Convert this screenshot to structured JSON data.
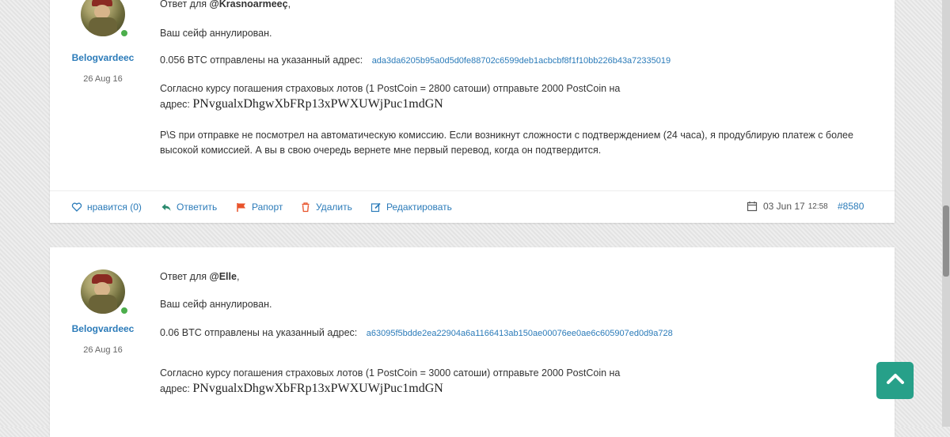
{
  "posts": [
    {
      "author": "Belogvardeec",
      "date": "26 Aug 16",
      "reply_prefix": "Ответ для",
      "mention": "@Krasnoarmeeç",
      "mention_suffix": ",",
      "line1": "Ваш сейф аннулирован.",
      "sent_text": "0.056 BTC отправлены на указанный адрес:",
      "sent_address": "ada3da6205b95a0d5d0fe88702c6599deb1acbcbf8f1f10bb226b43a72335019",
      "rate_text": "Согласно курсу погашения страховых лотов (1 PostCoin = 2800 сатоши) отправьте 2000  PostCoin на",
      "addr_label": "адрес:",
      "postcoin_address": "PNvgualxDhgwXbFRp13xPWXUWjPuc1mdGN",
      "ps_text": "P\\S при отправке не посмотрел на автоматическую комиссию. Если возникнут сложности с подтверждением (24 часа), я продублирую платеж с более высокой комиссией. А вы в свою очередь вернете мне первый перевод, когда он подтвердится.",
      "footer": {
        "like": "нравится (0)",
        "reply": "Ответить",
        "report": "Рапорт",
        "delete": "Удалить",
        "edit": "Редактировать",
        "post_date": "03 Jun 17",
        "post_time": "12:58",
        "post_id": "#8580"
      }
    },
    {
      "author": "Belogvardeec",
      "date": "26 Aug 16",
      "reply_prefix": "Ответ для",
      "mention": "@Elle",
      "mention_suffix": ",",
      "line1": "Ваш сейф аннулирован.",
      "sent_text": "0.06 BTC отправлены на указанный адрес:",
      "sent_address": "a63095f5bdde2ea22904a6a1166413ab150ae00076ee0ae6c605907ed0d9a728",
      "rate_text": "Согласно курсу погашения страховых лотов (1 PostCoin = 3000 сатоши) отправьте 2000  PostCoin на",
      "addr_label": "адрес:",
      "postcoin_address": "PNvgualxDhgwXbFRp13xPWXUWjPuc1mdGN"
    }
  ],
  "colors": {
    "link": "#2b7bb9",
    "online": "#4cae4c",
    "back_to_top": "#27a089",
    "report_flag": "#e8532b",
    "delete_icon": "#e8532b",
    "reply_icon": "#2a8a6e"
  },
  "icons": {
    "like": "heart-icon",
    "reply": "reply-arrow-icon",
    "report": "flag-icon",
    "delete": "trash-icon",
    "edit": "edit-icon",
    "date": "calendar-icon",
    "back_to_top": "chevron-up-icon"
  }
}
